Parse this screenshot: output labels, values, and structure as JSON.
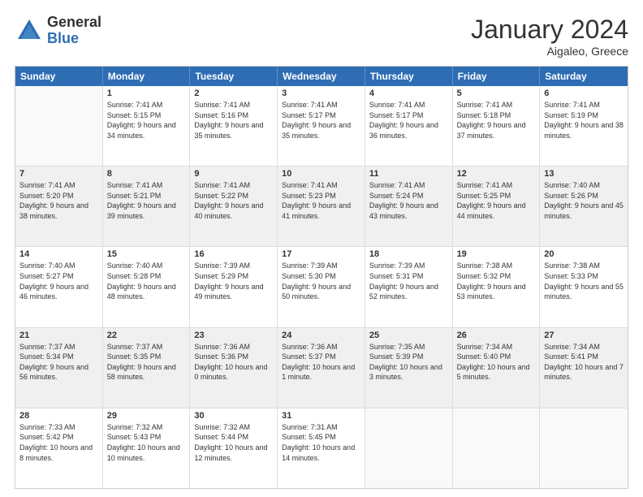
{
  "logo": {
    "general": "General",
    "blue": "Blue"
  },
  "header": {
    "title": "January 2024",
    "subtitle": "Aigaleo, Greece"
  },
  "weekdays": [
    "Sunday",
    "Monday",
    "Tuesday",
    "Wednesday",
    "Thursday",
    "Friday",
    "Saturday"
  ],
  "weeks": [
    [
      {
        "day": "",
        "sunrise": "",
        "sunset": "",
        "daylight": "",
        "empty": true
      },
      {
        "day": "1",
        "sunrise": "Sunrise: 7:41 AM",
        "sunset": "Sunset: 5:15 PM",
        "daylight": "Daylight: 9 hours and 34 minutes."
      },
      {
        "day": "2",
        "sunrise": "Sunrise: 7:41 AM",
        "sunset": "Sunset: 5:16 PM",
        "daylight": "Daylight: 9 hours and 35 minutes."
      },
      {
        "day": "3",
        "sunrise": "Sunrise: 7:41 AM",
        "sunset": "Sunset: 5:17 PM",
        "daylight": "Daylight: 9 hours and 35 minutes."
      },
      {
        "day": "4",
        "sunrise": "Sunrise: 7:41 AM",
        "sunset": "Sunset: 5:17 PM",
        "daylight": "Daylight: 9 hours and 36 minutes."
      },
      {
        "day": "5",
        "sunrise": "Sunrise: 7:41 AM",
        "sunset": "Sunset: 5:18 PM",
        "daylight": "Daylight: 9 hours and 37 minutes."
      },
      {
        "day": "6",
        "sunrise": "Sunrise: 7:41 AM",
        "sunset": "Sunset: 5:19 PM",
        "daylight": "Daylight: 9 hours and 38 minutes."
      }
    ],
    [
      {
        "day": "7",
        "sunrise": "Sunrise: 7:41 AM",
        "sunset": "Sunset: 5:20 PM",
        "daylight": "Daylight: 9 hours and 38 minutes."
      },
      {
        "day": "8",
        "sunrise": "Sunrise: 7:41 AM",
        "sunset": "Sunset: 5:21 PM",
        "daylight": "Daylight: 9 hours and 39 minutes."
      },
      {
        "day": "9",
        "sunrise": "Sunrise: 7:41 AM",
        "sunset": "Sunset: 5:22 PM",
        "daylight": "Daylight: 9 hours and 40 minutes."
      },
      {
        "day": "10",
        "sunrise": "Sunrise: 7:41 AM",
        "sunset": "Sunset: 5:23 PM",
        "daylight": "Daylight: 9 hours and 41 minutes."
      },
      {
        "day": "11",
        "sunrise": "Sunrise: 7:41 AM",
        "sunset": "Sunset: 5:24 PM",
        "daylight": "Daylight: 9 hours and 43 minutes."
      },
      {
        "day": "12",
        "sunrise": "Sunrise: 7:41 AM",
        "sunset": "Sunset: 5:25 PM",
        "daylight": "Daylight: 9 hours and 44 minutes."
      },
      {
        "day": "13",
        "sunrise": "Sunrise: 7:40 AM",
        "sunset": "Sunset: 5:26 PM",
        "daylight": "Daylight: 9 hours and 45 minutes."
      }
    ],
    [
      {
        "day": "14",
        "sunrise": "Sunrise: 7:40 AM",
        "sunset": "Sunset: 5:27 PM",
        "daylight": "Daylight: 9 hours and 46 minutes."
      },
      {
        "day": "15",
        "sunrise": "Sunrise: 7:40 AM",
        "sunset": "Sunset: 5:28 PM",
        "daylight": "Daylight: 9 hours and 48 minutes."
      },
      {
        "day": "16",
        "sunrise": "Sunrise: 7:39 AM",
        "sunset": "Sunset: 5:29 PM",
        "daylight": "Daylight: 9 hours and 49 minutes."
      },
      {
        "day": "17",
        "sunrise": "Sunrise: 7:39 AM",
        "sunset": "Sunset: 5:30 PM",
        "daylight": "Daylight: 9 hours and 50 minutes."
      },
      {
        "day": "18",
        "sunrise": "Sunrise: 7:39 AM",
        "sunset": "Sunset: 5:31 PM",
        "daylight": "Daylight: 9 hours and 52 minutes."
      },
      {
        "day": "19",
        "sunrise": "Sunrise: 7:38 AM",
        "sunset": "Sunset: 5:32 PM",
        "daylight": "Daylight: 9 hours and 53 minutes."
      },
      {
        "day": "20",
        "sunrise": "Sunrise: 7:38 AM",
        "sunset": "Sunset: 5:33 PM",
        "daylight": "Daylight: 9 hours and 55 minutes."
      }
    ],
    [
      {
        "day": "21",
        "sunrise": "Sunrise: 7:37 AM",
        "sunset": "Sunset: 5:34 PM",
        "daylight": "Daylight: 9 hours and 56 minutes."
      },
      {
        "day": "22",
        "sunrise": "Sunrise: 7:37 AM",
        "sunset": "Sunset: 5:35 PM",
        "daylight": "Daylight: 9 hours and 58 minutes."
      },
      {
        "day": "23",
        "sunrise": "Sunrise: 7:36 AM",
        "sunset": "Sunset: 5:36 PM",
        "daylight": "Daylight: 10 hours and 0 minutes."
      },
      {
        "day": "24",
        "sunrise": "Sunrise: 7:36 AM",
        "sunset": "Sunset: 5:37 PM",
        "daylight": "Daylight: 10 hours and 1 minute."
      },
      {
        "day": "25",
        "sunrise": "Sunrise: 7:35 AM",
        "sunset": "Sunset: 5:39 PM",
        "daylight": "Daylight: 10 hours and 3 minutes."
      },
      {
        "day": "26",
        "sunrise": "Sunrise: 7:34 AM",
        "sunset": "Sunset: 5:40 PM",
        "daylight": "Daylight: 10 hours and 5 minutes."
      },
      {
        "day": "27",
        "sunrise": "Sunrise: 7:34 AM",
        "sunset": "Sunset: 5:41 PM",
        "daylight": "Daylight: 10 hours and 7 minutes."
      }
    ],
    [
      {
        "day": "28",
        "sunrise": "Sunrise: 7:33 AM",
        "sunset": "Sunset: 5:42 PM",
        "daylight": "Daylight: 10 hours and 8 minutes."
      },
      {
        "day": "29",
        "sunrise": "Sunrise: 7:32 AM",
        "sunset": "Sunset: 5:43 PM",
        "daylight": "Daylight: 10 hours and 10 minutes."
      },
      {
        "day": "30",
        "sunrise": "Sunrise: 7:32 AM",
        "sunset": "Sunset: 5:44 PM",
        "daylight": "Daylight: 10 hours and 12 minutes."
      },
      {
        "day": "31",
        "sunrise": "Sunrise: 7:31 AM",
        "sunset": "Sunset: 5:45 PM",
        "daylight": "Daylight: 10 hours and 14 minutes."
      },
      {
        "day": "",
        "empty": true
      },
      {
        "day": "",
        "empty": true
      },
      {
        "day": "",
        "empty": true
      }
    ]
  ]
}
